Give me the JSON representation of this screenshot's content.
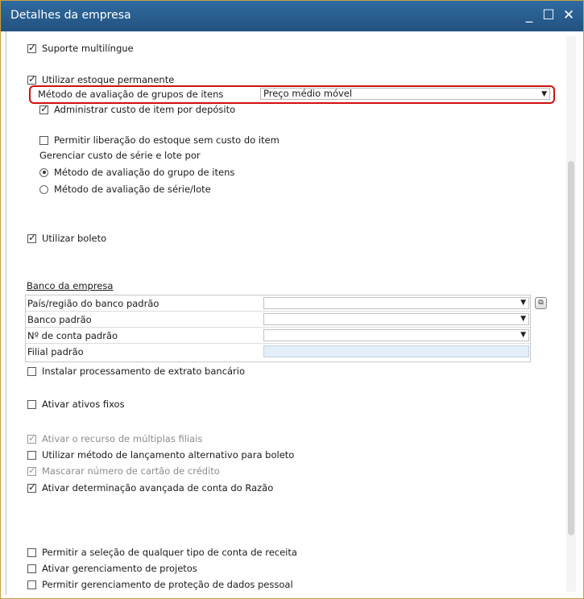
{
  "window": {
    "title": "Detalhes da empresa",
    "minimize_glyph": "_",
    "maximize_glyph": "☐",
    "close_glyph": "✕"
  },
  "options": {
    "multilingual": {
      "label": "Suporte multilíngue",
      "checked": true
    },
    "perpetual_inventory": {
      "label": "Utilizar estoque permanente",
      "checked": true
    },
    "valuation_method_label": "Método de avaliação de grupos de itens",
    "valuation_method_value": "Preço médio móvel",
    "manage_cost_per_warehouse": {
      "label": "Administrar custo de item por depósito",
      "checked": true
    },
    "allow_release_without_cost": {
      "label": "Permitir liberação do estoque sem custo do item",
      "checked": false
    },
    "serial_batch_heading": "Gerenciar custo de série e lote por",
    "radio_group_method": {
      "label": "Método de avaliação do grupo de itens",
      "selected": true
    },
    "radio_serial_method": {
      "label": "Método de avaliação de série/lote",
      "selected": false
    },
    "use_boleto": {
      "label": "Utilizar boleto",
      "checked": true
    }
  },
  "bank": {
    "heading": "Banco da empresa",
    "rows": [
      {
        "label": "País/região do banco padrão",
        "value": ""
      },
      {
        "label": "Banco padrão",
        "value": ""
      },
      {
        "label": "Nº de conta padrão",
        "value": ""
      },
      {
        "label": "Filial padrão",
        "value": ""
      }
    ],
    "link_icon": "⧉"
  },
  "more_options": {
    "bank_statement": {
      "label": "Instalar processamento de extrato bancário",
      "checked": false
    },
    "fixed_assets": {
      "label": "Ativar ativos fixos",
      "checked": false
    },
    "multi_branch": {
      "label": "Ativar o recurso de múltiplas filiais",
      "checked": true,
      "disabled": true
    },
    "alt_boleto_posting": {
      "label": "Utilizar método de lançamento alternativo para boleto",
      "checked": false
    },
    "mask_credit_card": {
      "label": "Mascarar número de cartão de crédito",
      "checked": true,
      "disabled": true
    },
    "advanced_gl": {
      "label": "Ativar determinação avançada de conta do Razão",
      "checked": true
    },
    "any_revenue_account": {
      "label": "Permitir a seleção de qualquer tipo de conta de receita",
      "checked": false
    },
    "project_management": {
      "label": "Ativar gerenciamento de projetos",
      "checked": false
    },
    "data_protection": {
      "label": "Permitir gerenciamento de proteção de dados pessoal",
      "checked": false
    }
  },
  "colors": {
    "titlebar": "#2a5f93",
    "highlight": "#d01010",
    "readonly_field": "#e4eef8"
  }
}
